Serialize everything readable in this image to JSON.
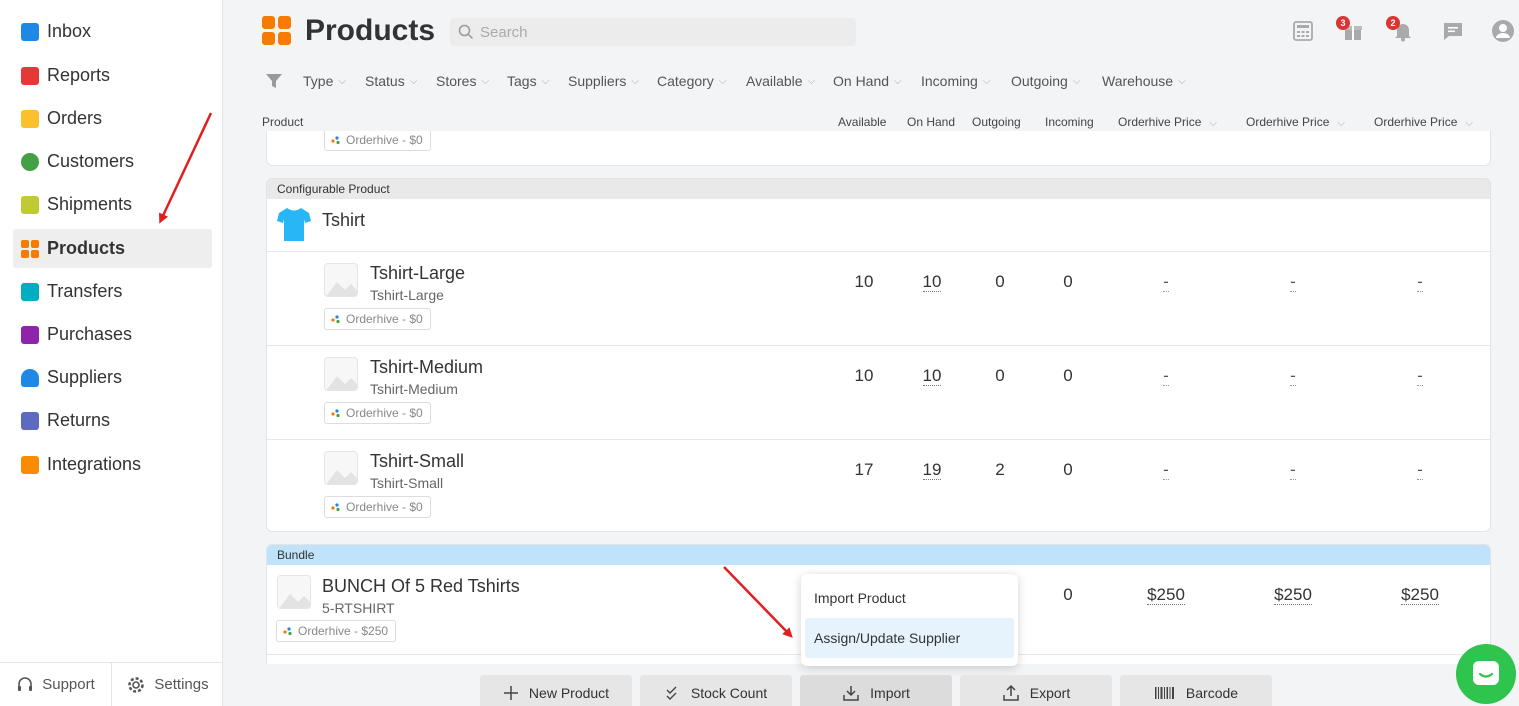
{
  "sidebar": {
    "items": [
      {
        "label": "Inbox",
        "icon": "inbox-icon",
        "color": "#1e88e5"
      },
      {
        "label": "Reports",
        "icon": "reports-icon",
        "color": "#e53935"
      },
      {
        "label": "Orders",
        "icon": "orders-icon",
        "color": "#fbc02d"
      },
      {
        "label": "Customers",
        "icon": "customers-icon",
        "color": "#43a047"
      },
      {
        "label": "Shipments",
        "icon": "shipments-icon",
        "color": "#c0ca33"
      },
      {
        "label": "Products",
        "icon": "products-icon",
        "color": "#f57c00"
      },
      {
        "label": "Transfers",
        "icon": "transfers-icon",
        "color": "#00acc1"
      },
      {
        "label": "Purchases",
        "icon": "purchases-icon",
        "color": "#8e24aa"
      },
      {
        "label": "Suppliers",
        "icon": "suppliers-icon",
        "color": "#1e88e5"
      },
      {
        "label": "Returns",
        "icon": "returns-icon",
        "color": "#5c6bc0"
      },
      {
        "label": "Integrations",
        "icon": "integrations-icon",
        "color": "#fb8c00"
      }
    ],
    "active": "Products",
    "footer": {
      "support": "Support",
      "settings": "Settings"
    }
  },
  "header": {
    "title": "Products",
    "search_placeholder": "Search",
    "gift_badge": "3",
    "bell_badge": "2"
  },
  "filters": [
    "Type",
    "Status",
    "Stores",
    "Tags",
    "Suppliers",
    "Category",
    "Available",
    "On Hand",
    "Incoming",
    "Outgoing",
    "Warehouse"
  ],
  "columns": {
    "product": "Product",
    "available": "Available",
    "on_hand": "On Hand",
    "outgoing": "Outgoing",
    "incoming": "Incoming",
    "price1": "Orderhive Price",
    "price2": "Orderhive Price",
    "price3": "Orderhive Price"
  },
  "top_partial_store_tag": "Orderhive - $0",
  "configurable": {
    "label": "Configurable Product",
    "parent_name": "Tshirt",
    "variants": [
      {
        "name": "Tshirt-Large",
        "sku": "Tshirt-Large",
        "store": "Orderhive - $0",
        "available": "10",
        "on_hand": "10",
        "outgoing": "0",
        "incoming": "0",
        "p1": "-",
        "p2": "-",
        "p3": "-"
      },
      {
        "name": "Tshirt-Medium",
        "sku": "Tshirt-Medium",
        "store": "Orderhive - $0",
        "available": "10",
        "on_hand": "10",
        "outgoing": "0",
        "incoming": "0",
        "p1": "-",
        "p2": "-",
        "p3": "-"
      },
      {
        "name": "Tshirt-Small",
        "sku": "Tshirt-Small",
        "store": "Orderhive - $0",
        "available": "17",
        "on_hand": "19",
        "outgoing": "2",
        "incoming": "0",
        "p1": "-",
        "p2": "-",
        "p3": "-"
      }
    ]
  },
  "bundle": {
    "label": "Bundle",
    "name": "BUNCH Of 5 Red Tshirts",
    "sku": "5-RTSHIRT",
    "store": "Orderhive - $250",
    "incoming": "0",
    "p1": "$250",
    "p2": "$250",
    "p3": "$250"
  },
  "import_menu": {
    "items": [
      "Import Product",
      "Assign/Update Supplier"
    ]
  },
  "toolbar": {
    "new_product": "New Product",
    "stock_count": "Stock Count",
    "import": "Import",
    "export": "Export",
    "barcode": "Barcode"
  },
  "colors": {
    "accent_orange": "#f57c00",
    "badge_red": "#d33333",
    "chat_green": "#2ec44e",
    "bundle_blue": "#bfe3fb",
    "arrow_red": "#e02020"
  }
}
